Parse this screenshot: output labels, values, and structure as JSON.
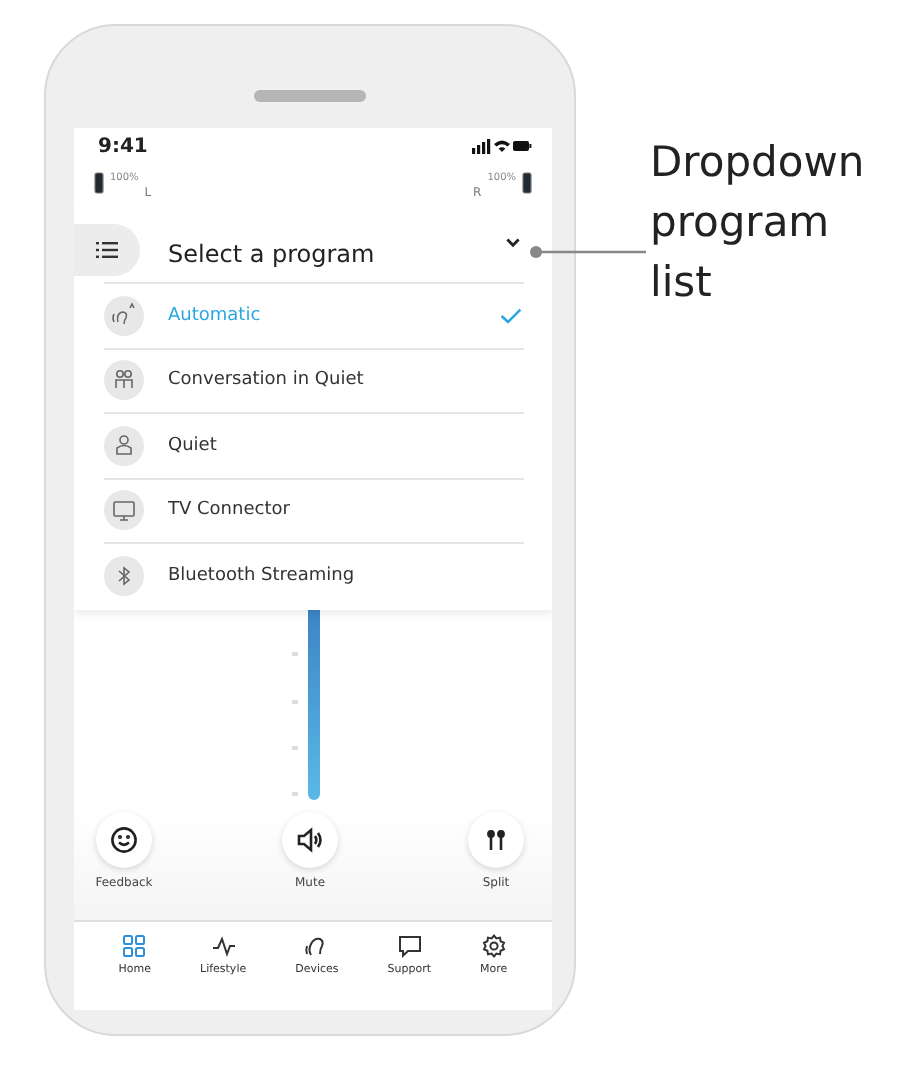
{
  "status_bar": {
    "time": "9:41"
  },
  "hearing_aids": [
    {
      "side": "L",
      "battery": "100%"
    },
    {
      "side": "R",
      "battery": "100%"
    }
  ],
  "program_dropdown": {
    "title": "Select a program",
    "expanded": true,
    "items": [
      {
        "label": "Automatic",
        "selected": true,
        "kind": "automatic"
      },
      {
        "label": "Conversation in Quiet",
        "selected": false,
        "kind": "conversation"
      },
      {
        "label": "Quiet",
        "selected": false,
        "kind": "quiet"
      },
      {
        "label": "TV Connector",
        "selected": false,
        "kind": "tv"
      },
      {
        "label": "Bluetooth Streaming",
        "selected": false,
        "kind": "bluetooth"
      }
    ]
  },
  "actions": [
    {
      "label": "Feedback",
      "kind": "feedback"
    },
    {
      "label": "Mute",
      "kind": "mute"
    },
    {
      "label": "Split",
      "kind": "split"
    }
  ],
  "tab_bar": [
    {
      "label": "Home",
      "selected": true,
      "kind": "home"
    },
    {
      "label": "Lifestyle",
      "selected": false,
      "kind": "lifestyle"
    },
    {
      "label": "Devices",
      "selected": false,
      "kind": "devices"
    },
    {
      "label": "Support",
      "selected": false,
      "kind": "support"
    },
    {
      "label": "More",
      "selected": false,
      "kind": "more"
    }
  ],
  "annotation": {
    "text": "Dropdown program list"
  }
}
